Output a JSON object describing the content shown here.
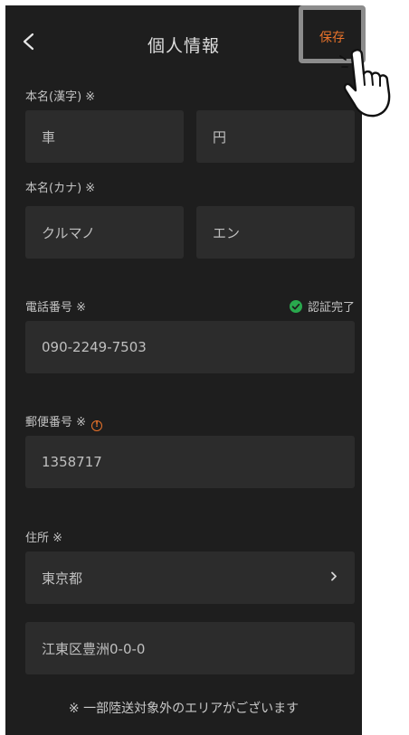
{
  "header": {
    "back_icon": "chevron-left-icon",
    "title": "個人情報",
    "save_label": "保存"
  },
  "kanji_name": {
    "label": "本名(漢字) ※",
    "last": "車",
    "first": "円"
  },
  "kana_name": {
    "label": "本名(カナ) ※",
    "last": "クルマノ",
    "first": "エン"
  },
  "phone": {
    "label": "電話番号 ※",
    "status_icon": "check-circle-icon",
    "status": "認証完了",
    "status_color": "#29a84d",
    "value": "090-2249-7503"
  },
  "postal": {
    "label": "郵便番号 ※",
    "warning_icon": "info-circle-icon",
    "value": "1358717"
  },
  "address": {
    "label": "住所 ※",
    "prefecture": "東京都",
    "chevron_icon": "chevron-right-icon",
    "street": "江東区豊洲0-0-0"
  },
  "note": "※ 一部陸送対象外のエリアがございます",
  "colors": {
    "background": "#1e1e1e",
    "field": "#2c2c2c",
    "accent": "#e8722a"
  }
}
